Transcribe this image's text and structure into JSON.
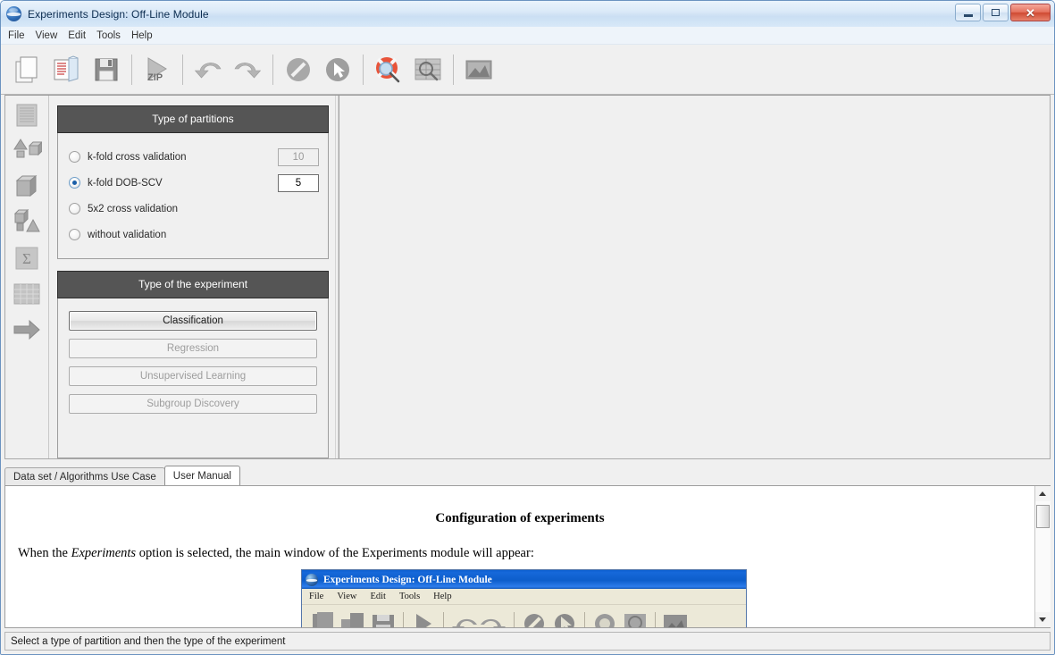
{
  "window": {
    "title": "Experiments Design: Off-Line Module",
    "icon": "globe-icon",
    "buttons": {
      "minimize": "minimize-icon",
      "maximize": "maximize-icon",
      "close": "✕"
    }
  },
  "menubar": {
    "items": [
      "File",
      "View",
      "Edit",
      "Tools",
      "Help"
    ]
  },
  "toolbar": {
    "items": [
      {
        "name": "new-document-icon",
        "tooltip": "New"
      },
      {
        "name": "open-document-icon",
        "tooltip": "Open"
      },
      {
        "name": "save-floppy-icon",
        "tooltip": "Save"
      },
      {
        "name": "zip-export-icon",
        "tooltip": "ZIP"
      },
      {
        "name": "undo-arrow-icon",
        "tooltip": "Undo"
      },
      {
        "name": "redo-arrow-icon",
        "tooltip": "Redo"
      },
      {
        "name": "forbidden-icon",
        "tooltip": "Cancel"
      },
      {
        "name": "cursor-circle-icon",
        "tooltip": "Select"
      },
      {
        "name": "lifebuoy-search-icon",
        "tooltip": "Help search"
      },
      {
        "name": "zoom-table-icon",
        "tooltip": "Inspect"
      },
      {
        "name": "image-chart-icon",
        "tooltip": "Graphic"
      }
    ]
  },
  "rail": {
    "items": [
      {
        "name": "rail-dataset-icon"
      },
      {
        "name": "rail-shapes-icon"
      },
      {
        "name": "rail-cube-icon"
      },
      {
        "name": "rail-algorithms-icon"
      },
      {
        "name": "rail-sigma-icon"
      },
      {
        "name": "rail-table-icon"
      },
      {
        "name": "rail-arrow-icon"
      }
    ]
  },
  "partitions": {
    "title": "Type of partitions",
    "options": [
      {
        "label": "k-fold cross validation",
        "selected": false,
        "value": "10",
        "value_enabled": false
      },
      {
        "label": "k-fold DOB-SCV",
        "selected": true,
        "value": "5",
        "value_enabled": true
      },
      {
        "label": "5x2 cross validation",
        "selected": false
      },
      {
        "label": "without validation",
        "selected": false
      }
    ]
  },
  "experiment": {
    "title": "Type of the experiment",
    "buttons": [
      {
        "label": "Classification",
        "selected": true
      },
      {
        "label": "Regression",
        "selected": false
      },
      {
        "label": "Unsupervised Learning",
        "selected": false
      },
      {
        "label": "Subgroup Discovery",
        "selected": false
      }
    ]
  },
  "tabs": [
    {
      "label": "Data set / Algorithms Use Case",
      "active": false
    },
    {
      "label": "User Manual",
      "active": true
    }
  ],
  "manual": {
    "heading": "Configuration of experiments",
    "paragraph_before": "When the ",
    "paragraph_italic": "Experiments",
    "paragraph_after": " option is selected, the main window of the Experiments module will appear:",
    "embedded_window": {
      "title": "Experiments Design: Off-Line Module",
      "menu": [
        "File",
        "View",
        "Edit",
        "Tools",
        "Help"
      ]
    }
  },
  "scrollbar": {
    "up": "scroll-up-arrow-icon",
    "down": "scroll-down-arrow-icon"
  },
  "statusbar": {
    "message": "Select a type of partition and then the type of the experiment"
  },
  "colors": {
    "group_header_bg": "#555555",
    "titlebar_text": "#0c2d50",
    "radio_selected": "#1b5fa8",
    "close_button": "#cf4a32"
  }
}
